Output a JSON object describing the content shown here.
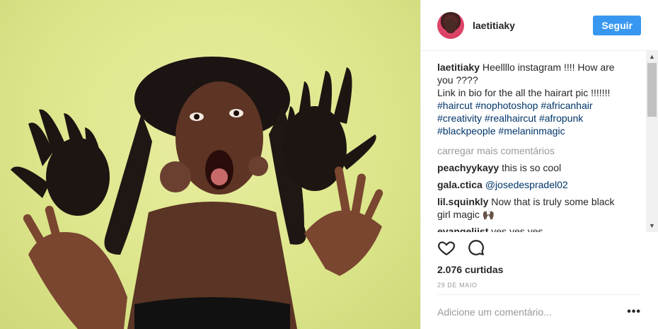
{
  "post": {
    "username": "laetitiaky",
    "follow_label": "Seguir",
    "caption": {
      "username": "laetitiaky",
      "lines": [
        "Heellllo instagram !!!! How are",
        "you ????",
        "Link in bio for the all the hairart pic !!!!!!!"
      ],
      "hashtag_lines": [
        [
          "#haircut",
          "#nophotoshop",
          "#africanhair"
        ],
        [
          "#creativity",
          "#realhaircut",
          "#afropunk"
        ],
        [
          "#blackpeople",
          "#melaninmagic"
        ]
      ]
    },
    "load_more_label": "carregar mais comentários",
    "comments": [
      {
        "user": "peachyykayy",
        "text": "this is so cool",
        "text2": ""
      },
      {
        "user": "gala.ctica",
        "mention": "@josedespradel02",
        "text": ""
      },
      {
        "user": "lil.squinkly",
        "text": "Now that is truly some black",
        "text2": "girl magic 🙌🏿"
      },
      {
        "user": "evangeliist",
        "text": "yes yes yes",
        "text2": ""
      }
    ],
    "likes": "2.076 curtidas",
    "date": "29 DE MAIO",
    "add_comment_placeholder": "Adicione um comentário...",
    "more_label": "•••"
  },
  "icons": {
    "like": "heart-outline-icon",
    "comment": "speech-bubble-icon"
  },
  "colors": {
    "accent": "#3897f0",
    "hashtag": "#003569",
    "muted": "#999999",
    "background_photo": "#dde68c"
  }
}
